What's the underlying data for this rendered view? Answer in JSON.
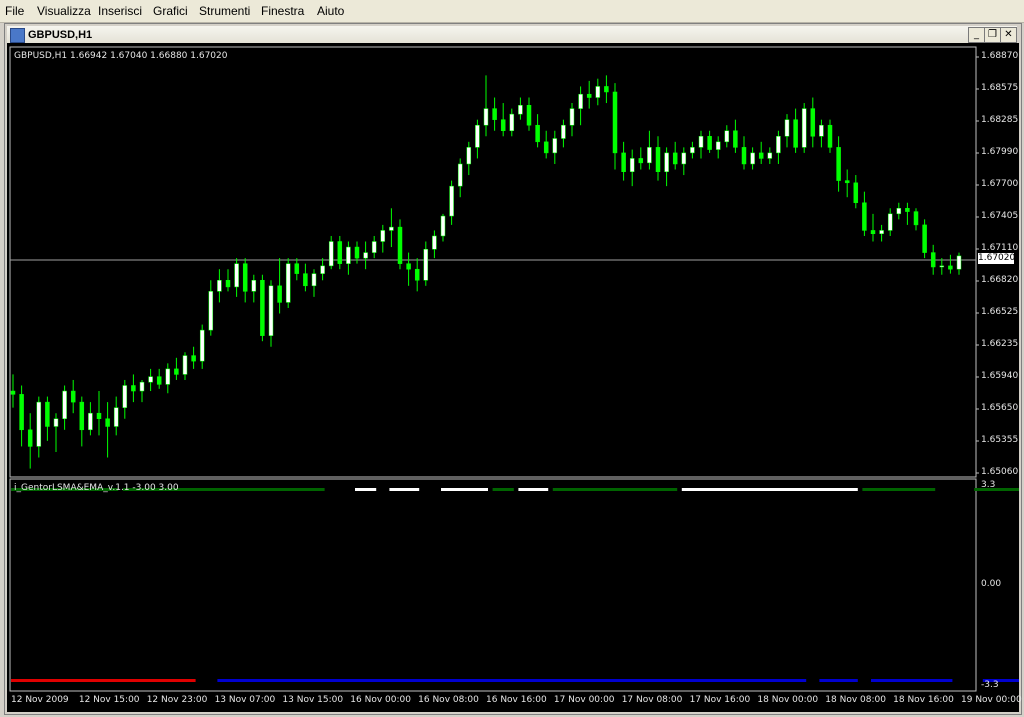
{
  "menu": [
    "File",
    "Visualizza",
    "Inserisci",
    "Grafici",
    "Strumenti",
    "Finestra",
    "Aiuto"
  ],
  "window": {
    "title": "GBPUSD,H1",
    "min": "_",
    "restore": "❐",
    "close": "✕"
  },
  "price_label": "GBPUSD,H1  1.66942 1.67040 1.66880 1.67020",
  "indicator_label": "i_GentorLSMA&EMA_v.1.1 -3.00 3.00",
  "current_price": "1.67020",
  "price_axis": [
    "1.68870",
    "1.68575",
    "1.68285",
    "1.67990",
    "1.67700",
    "1.67405",
    "1.67110",
    "1.66820",
    "1.66525",
    "1.66235",
    "1.65940",
    "1.65650",
    "1.65355",
    "1.65060"
  ],
  "indicator_axis": [
    "3.3",
    "0.00",
    "-3.3"
  ],
  "time_axis": [
    "12 Nov 2009",
    "12 Nov 15:00",
    "12 Nov 23:00",
    "13 Nov 07:00",
    "13 Nov 15:00",
    "16 Nov 00:00",
    "16 Nov 08:00",
    "16 Nov 16:00",
    "17 Nov 00:00",
    "17 Nov 08:00",
    "17 Nov 16:00",
    "18 Nov 00:00",
    "18 Nov 08:00",
    "18 Nov 16:00",
    "19 Nov 00:00"
  ],
  "colors": {
    "bull": "#ffffff",
    "bear": "#00ff00",
    "bg": "#000000",
    "top_green": "#006400",
    "top_white": "#ffffff",
    "bottom_red": "#e00000",
    "bottom_blue": "#0000d0"
  },
  "chart_data": {
    "type": "candlestick",
    "symbol": "GBPUSD",
    "timeframe": "H1",
    "ylim": [
      1.6506,
      1.6887
    ],
    "candles": [
      [
        1.658,
        1.6595,
        1.6565,
        1.6577
      ],
      [
        1.6577,
        1.6585,
        1.653,
        1.6545
      ],
      [
        1.6545,
        1.656,
        1.651,
        1.653
      ],
      [
        1.653,
        1.6575,
        1.652,
        1.657
      ],
      [
        1.657,
        1.6575,
        1.6535,
        1.6548
      ],
      [
        1.6548,
        1.656,
        1.6525,
        1.6555
      ],
      [
        1.6555,
        1.6585,
        1.6545,
        1.658
      ],
      [
        1.658,
        1.659,
        1.656,
        1.657
      ],
      [
        1.657,
        1.6575,
        1.653,
        1.6545
      ],
      [
        1.6545,
        1.657,
        1.654,
        1.656
      ],
      [
        1.656,
        1.658,
        1.654,
        1.6555
      ],
      [
        1.6555,
        1.657,
        1.652,
        1.6548
      ],
      [
        1.6548,
        1.6575,
        1.654,
        1.6565
      ],
      [
        1.6565,
        1.659,
        1.6555,
        1.6585
      ],
      [
        1.6585,
        1.6595,
        1.657,
        1.658
      ],
      [
        1.658,
        1.659,
        1.657,
        1.6588
      ],
      [
        1.6588,
        1.66,
        1.658,
        1.6593
      ],
      [
        1.6593,
        1.66,
        1.6582,
        1.6586
      ],
      [
        1.6586,
        1.6605,
        1.6578,
        1.66
      ],
      [
        1.66,
        1.661,
        1.659,
        1.6595
      ],
      [
        1.6595,
        1.6615,
        1.659,
        1.6612
      ],
      [
        1.6612,
        1.662,
        1.66,
        1.6607
      ],
      [
        1.6607,
        1.664,
        1.66,
        1.6635
      ],
      [
        1.6635,
        1.668,
        1.663,
        1.667
      ],
      [
        1.667,
        1.669,
        1.666,
        1.668
      ],
      [
        1.668,
        1.669,
        1.667,
        1.6674
      ],
      [
        1.6674,
        1.67,
        1.6665,
        1.6695
      ],
      [
        1.6695,
        1.67,
        1.666,
        1.667
      ],
      [
        1.667,
        1.6685,
        1.666,
        1.668
      ],
      [
        1.668,
        1.6685,
        1.6625,
        1.663
      ],
      [
        1.663,
        1.668,
        1.662,
        1.6675
      ],
      [
        1.6675,
        1.67,
        1.665,
        1.666
      ],
      [
        1.666,
        1.67,
        1.6655,
        1.6695
      ],
      [
        1.6695,
        1.67,
        1.668,
        1.6686
      ],
      [
        1.6686,
        1.6695,
        1.667,
        1.6675
      ],
      [
        1.6675,
        1.669,
        1.6665,
        1.6686
      ],
      [
        1.6686,
        1.67,
        1.668,
        1.6693
      ],
      [
        1.6693,
        1.672,
        1.669,
        1.6715
      ],
      [
        1.6715,
        1.672,
        1.669,
        1.6695
      ],
      [
        1.6695,
        1.6715,
        1.6685,
        1.671
      ],
      [
        1.671,
        1.6715,
        1.6695,
        1.67
      ],
      [
        1.67,
        1.6715,
        1.669,
        1.6705
      ],
      [
        1.6705,
        1.672,
        1.67,
        1.6715
      ],
      [
        1.6715,
        1.673,
        1.6705,
        1.6725
      ],
      [
        1.6725,
        1.6745,
        1.671,
        1.6728
      ],
      [
        1.6728,
        1.6735,
        1.669,
        1.6695
      ],
      [
        1.6695,
        1.6705,
        1.6675,
        1.669
      ],
      [
        1.669,
        1.67,
        1.667,
        1.668
      ],
      [
        1.668,
        1.6715,
        1.6675,
        1.6708
      ],
      [
        1.6708,
        1.6725,
        1.67,
        1.672
      ],
      [
        1.672,
        1.674,
        1.6715,
        1.6738
      ],
      [
        1.6738,
        1.677,
        1.673,
        1.6765
      ],
      [
        1.6765,
        1.679,
        1.6755,
        1.6785
      ],
      [
        1.6785,
        1.6805,
        1.6775,
        1.68
      ],
      [
        1.68,
        1.6825,
        1.679,
        1.682
      ],
      [
        1.682,
        1.6865,
        1.681,
        1.6835
      ],
      [
        1.6835,
        1.6845,
        1.6815,
        1.6825
      ],
      [
        1.6825,
        1.684,
        1.681,
        1.6815
      ],
      [
        1.6815,
        1.6835,
        1.681,
        1.683
      ],
      [
        1.683,
        1.6845,
        1.6825,
        1.6838
      ],
      [
        1.6838,
        1.6845,
        1.6815,
        1.682
      ],
      [
        1.682,
        1.683,
        1.68,
        1.6805
      ],
      [
        1.6805,
        1.6815,
        1.679,
        1.6795
      ],
      [
        1.6795,
        1.6815,
        1.6785,
        1.6808
      ],
      [
        1.6808,
        1.6825,
        1.68,
        1.682
      ],
      [
        1.682,
        1.684,
        1.681,
        1.6835
      ],
      [
        1.6835,
        1.6855,
        1.682,
        1.6848
      ],
      [
        1.6848,
        1.686,
        1.6835,
        1.6845
      ],
      [
        1.6845,
        1.6862,
        1.6838,
        1.6855
      ],
      [
        1.6855,
        1.6865,
        1.684,
        1.685
      ],
      [
        1.685,
        1.6858,
        1.678,
        1.6795
      ],
      [
        1.6795,
        1.6805,
        1.677,
        1.6778
      ],
      [
        1.6778,
        1.6798,
        1.6765,
        1.679
      ],
      [
        1.679,
        1.68,
        1.678,
        1.6786
      ],
      [
        1.6786,
        1.6815,
        1.678,
        1.68
      ],
      [
        1.68,
        1.681,
        1.677,
        1.6778
      ],
      [
        1.6778,
        1.68,
        1.6765,
        1.6795
      ],
      [
        1.6795,
        1.6805,
        1.678,
        1.6785
      ],
      [
        1.6785,
        1.68,
        1.6775,
        1.6795
      ],
      [
        1.6795,
        1.6805,
        1.679,
        1.68
      ],
      [
        1.68,
        1.6815,
        1.679,
        1.681
      ],
      [
        1.681,
        1.6815,
        1.6795,
        1.6798
      ],
      [
        1.6798,
        1.681,
        1.679,
        1.6805
      ],
      [
        1.6805,
        1.682,
        1.68,
        1.6815
      ],
      [
        1.6815,
        1.6825,
        1.6795,
        1.68
      ],
      [
        1.68,
        1.681,
        1.678,
        1.6785
      ],
      [
        1.6785,
        1.68,
        1.678,
        1.6795
      ],
      [
        1.6795,
        1.6805,
        1.6785,
        1.679
      ],
      [
        1.679,
        1.68,
        1.6785,
        1.6795
      ],
      [
        1.6795,
        1.6815,
        1.6785,
        1.681
      ],
      [
        1.681,
        1.683,
        1.68,
        1.6825
      ],
      [
        1.6825,
        1.6835,
        1.6795,
        1.68
      ],
      [
        1.68,
        1.684,
        1.6795,
        1.6835
      ],
      [
        1.6835,
        1.6845,
        1.68,
        1.681
      ],
      [
        1.681,
        1.6825,
        1.68,
        1.682
      ],
      [
        1.682,
        1.6825,
        1.6795,
        1.68
      ],
      [
        1.68,
        1.681,
        1.676,
        1.677
      ],
      [
        1.677,
        1.678,
        1.6755,
        1.6768
      ],
      [
        1.6768,
        1.6775,
        1.6745,
        1.675
      ],
      [
        1.675,
        1.676,
        1.672,
        1.6725
      ],
      [
        1.6725,
        1.674,
        1.6715,
        1.6722
      ],
      [
        1.6722,
        1.673,
        1.6715,
        1.6725
      ],
      [
        1.6725,
        1.6745,
        1.672,
        1.674
      ],
      [
        1.674,
        1.675,
        1.6735,
        1.6745
      ],
      [
        1.6745,
        1.675,
        1.673,
        1.6742
      ],
      [
        1.6742,
        1.6745,
        1.6725,
        1.673
      ],
      [
        1.673,
        1.6735,
        1.67,
        1.6705
      ],
      [
        1.6705,
        1.6712,
        1.6685,
        1.6692
      ],
      [
        1.6692,
        1.67,
        1.6685,
        1.6693
      ],
      [
        1.6693,
        1.6703,
        1.6686,
        1.669
      ],
      [
        1.669,
        1.6705,
        1.6685,
        1.6702
      ]
    ],
    "indicator": {
      "name": "i_GentorLSMA&EMA_v.1.1",
      "range": [
        -3.3,
        3.3
      ],
      "top_segments": [
        {
          "from": 0,
          "to": 12,
          "color": "green"
        },
        {
          "from": 13,
          "to": 36,
          "color": "green"
        },
        {
          "from": 40,
          "to": 42,
          "color": "white"
        },
        {
          "from": 44,
          "to": 47,
          "color": "white"
        },
        {
          "from": 50,
          "to": 55,
          "color": "white"
        },
        {
          "from": 56,
          "to": 58,
          "color": "green"
        },
        {
          "from": 59,
          "to": 62,
          "color": "white"
        },
        {
          "from": 63,
          "to": 77,
          "color": "green"
        },
        {
          "from": 78,
          "to": 98,
          "color": "white"
        },
        {
          "from": 99,
          "to": 107,
          "color": "green"
        },
        {
          "from": 112,
          "to": 118,
          "color": "green"
        },
        {
          "from": 119,
          "to": 132,
          "color": "white"
        },
        {
          "from": 133,
          "to": 136,
          "color": "green"
        },
        {
          "from": 137,
          "to": 141,
          "color": "white"
        },
        {
          "from": 142,
          "to": 143,
          "color": "green"
        }
      ],
      "bottom_segments": [
        {
          "from": 0,
          "to": 21,
          "color": "red"
        },
        {
          "from": 24,
          "to": 92,
          "color": "blue"
        },
        {
          "from": 94,
          "to": 98,
          "color": "blue"
        },
        {
          "from": 100,
          "to": 109,
          "color": "blue"
        },
        {
          "from": 113,
          "to": 125,
          "color": "blue"
        },
        {
          "from": 127,
          "to": 143,
          "color": "red"
        }
      ]
    }
  }
}
